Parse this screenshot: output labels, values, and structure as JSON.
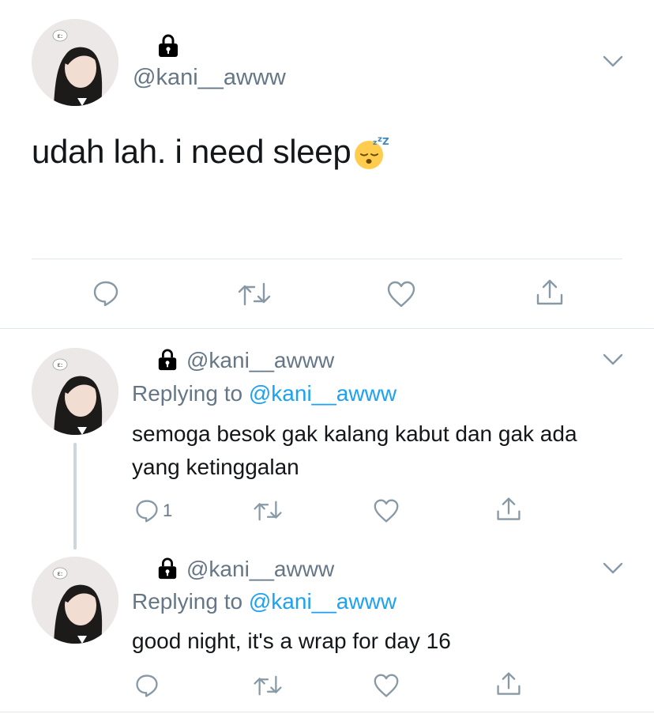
{
  "main_tweet": {
    "handle": "@kani__awww",
    "text": "udah lah. i need sleep",
    "emoji": "sleeping-face",
    "actions": [
      "reply-icon",
      "retweet-icon",
      "like-icon",
      "share-icon"
    ]
  },
  "replies": [
    {
      "handle": "@kani__awww",
      "replying_prefix": "Replying to ",
      "replying_to": "@kani__awww",
      "text": "semoga besok gak kalang kabut dan gak ada yang ketinggalan",
      "reply_count": "1"
    },
    {
      "handle": "@kani__awww",
      "replying_prefix": "Replying to ",
      "replying_to": "@kani__awww",
      "text": "good night, it's a wrap for day 16"
    }
  ],
  "colors": {
    "text": "#14171a",
    "muted": "#657786",
    "mention": "#1da1f2",
    "divider": "#e1e8ed",
    "thread_line": "#ccd6dd"
  }
}
